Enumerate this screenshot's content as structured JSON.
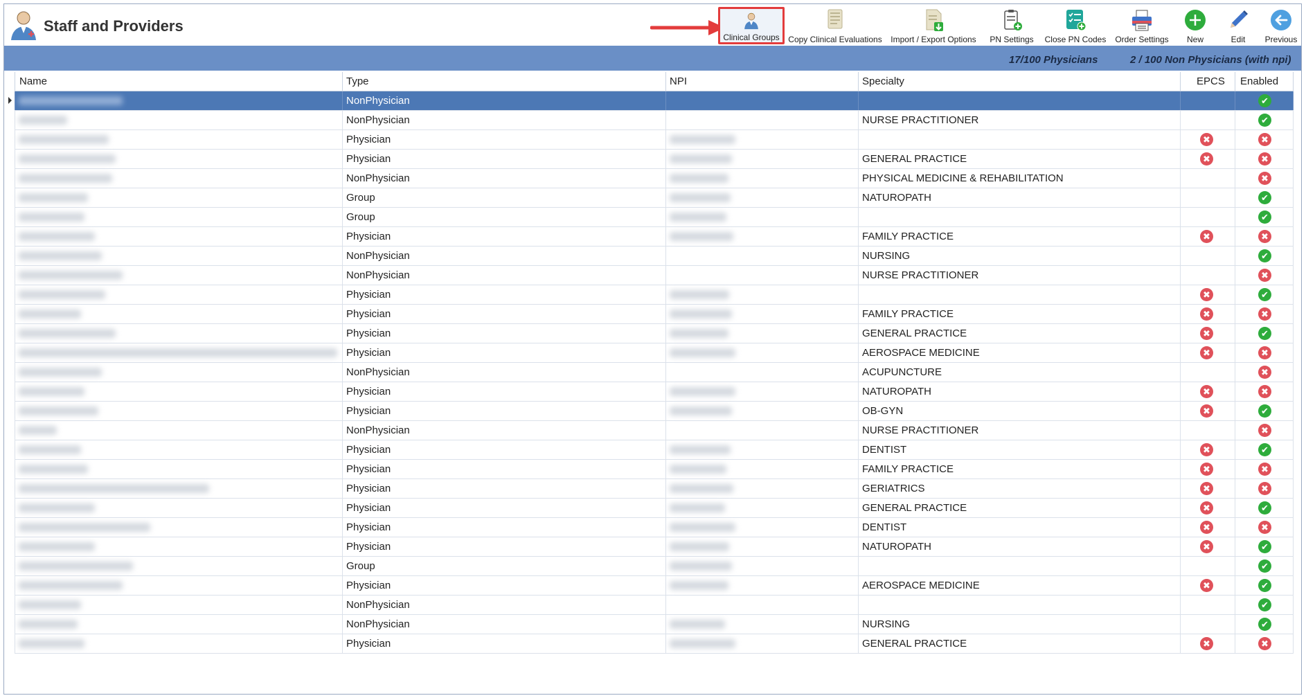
{
  "app": {
    "title": "Staff and Providers",
    "logo_icon": "staff-providers-icon"
  },
  "toolbar": [
    {
      "label": "Clinical Groups",
      "icon": "clinical-groups-icon",
      "highlighted": true
    },
    {
      "label": "Copy Clinical Evaluations",
      "icon": "copy-evaluations-icon"
    },
    {
      "label": "Import / Export Options",
      "icon": "import-export-icon"
    },
    {
      "label": "PN Settings",
      "icon": "pn-settings-icon"
    },
    {
      "label": "Close PN Codes",
      "icon": "close-pn-codes-icon"
    },
    {
      "label": "Order Settings",
      "icon": "printer-icon"
    },
    {
      "label": "New",
      "icon": "add-icon"
    },
    {
      "label": "Edit",
      "icon": "pencil-icon"
    },
    {
      "label": "Previous",
      "icon": "back-arrow-icon"
    }
  ],
  "stats": {
    "physicians": "17/100 Physicians",
    "non_physicians": "2 / 100 Non Physicians (with npi)"
  },
  "columns": {
    "name": "Name",
    "type": "Type",
    "npi": "NPI",
    "specialty": "Specialty",
    "epcs": "EPCS",
    "enabled": "Enabled"
  },
  "colors": {
    "stats_bar": "#6a8fc6",
    "selected_row": "#4c78b5",
    "ok": "#2eac3c",
    "error": "#e0515a",
    "highlight": "#e33c3c"
  },
  "rows": [
    {
      "type": "NonPhysician",
      "specialty": "",
      "npi": false,
      "epcs": null,
      "enabled": "ok",
      "selected": true
    },
    {
      "type": "NonPhysician",
      "specialty": "NURSE PRACTITIONER",
      "npi": false,
      "epcs": null,
      "enabled": "ok"
    },
    {
      "type": "Physician",
      "specialty": "",
      "npi": true,
      "epcs": "no",
      "enabled": "no"
    },
    {
      "type": "Physician",
      "specialty": "GENERAL PRACTICE",
      "npi": true,
      "epcs": "no",
      "enabled": "no"
    },
    {
      "type": "NonPhysician",
      "specialty": "PHYSICAL MEDICINE & REHABILITATION",
      "npi": true,
      "epcs": null,
      "enabled": "no"
    },
    {
      "type": "Group",
      "specialty": "NATUROPATH",
      "npi": true,
      "epcs": null,
      "enabled": "ok"
    },
    {
      "type": "Group",
      "specialty": "",
      "npi": true,
      "epcs": null,
      "enabled": "ok"
    },
    {
      "type": "Physician",
      "specialty": "FAMILY PRACTICE",
      "npi": true,
      "epcs": "no",
      "enabled": "no"
    },
    {
      "type": "NonPhysician",
      "specialty": "NURSING",
      "npi": false,
      "epcs": null,
      "enabled": "ok"
    },
    {
      "type": "NonPhysician",
      "specialty": "NURSE PRACTITIONER",
      "npi": false,
      "epcs": null,
      "enabled": "no"
    },
    {
      "type": "Physician",
      "specialty": "",
      "npi": true,
      "epcs": "no",
      "enabled": "ok"
    },
    {
      "type": "Physician",
      "specialty": "FAMILY PRACTICE",
      "npi": true,
      "epcs": "no",
      "enabled": "no"
    },
    {
      "type": "Physician",
      "specialty": "GENERAL PRACTICE",
      "npi": true,
      "epcs": "no",
      "enabled": "ok"
    },
    {
      "type": "Physician",
      "specialty": "AEROSPACE MEDICINE",
      "npi": true,
      "epcs": "no",
      "enabled": "no"
    },
    {
      "type": "NonPhysician",
      "specialty": "ACUPUNCTURE",
      "npi": false,
      "epcs": null,
      "enabled": "no"
    },
    {
      "type": "Physician",
      "specialty": "NATUROPATH",
      "npi": true,
      "epcs": "no",
      "enabled": "no"
    },
    {
      "type": "Physician",
      "specialty": "OB-GYN",
      "npi": true,
      "epcs": "no",
      "enabled": "ok"
    },
    {
      "type": "NonPhysician",
      "specialty": "NURSE PRACTITIONER",
      "npi": false,
      "epcs": null,
      "enabled": "no"
    },
    {
      "type": "Physician",
      "specialty": "DENTIST",
      "npi": true,
      "epcs": "no",
      "enabled": "ok"
    },
    {
      "type": "Physician",
      "specialty": "FAMILY PRACTICE",
      "npi": true,
      "epcs": "no",
      "enabled": "no"
    },
    {
      "type": "Physician",
      "specialty": "GERIATRICS",
      "npi": true,
      "epcs": "no",
      "enabled": "no"
    },
    {
      "type": "Physician",
      "specialty": "GENERAL PRACTICE",
      "npi": true,
      "epcs": "no",
      "enabled": "ok"
    },
    {
      "type": "Physician",
      "specialty": "DENTIST",
      "npi": true,
      "epcs": "no",
      "enabled": "no"
    },
    {
      "type": "Physician",
      "specialty": "NATUROPATH",
      "npi": true,
      "epcs": "no",
      "enabled": "ok"
    },
    {
      "type": "Group",
      "specialty": "",
      "npi": true,
      "epcs": null,
      "enabled": "ok"
    },
    {
      "type": "Physician",
      "specialty": "AEROSPACE MEDICINE",
      "npi": true,
      "epcs": "no",
      "enabled": "ok"
    },
    {
      "type": "NonPhysician",
      "specialty": "",
      "npi": false,
      "epcs": null,
      "enabled": "ok"
    },
    {
      "type": "NonPhysician",
      "specialty": "NURSING",
      "npi": true,
      "epcs": null,
      "enabled": "ok"
    },
    {
      "type": "Physician",
      "specialty": "GENERAL PRACTICE",
      "npi": true,
      "epcs": "no",
      "enabled": "no"
    }
  ]
}
